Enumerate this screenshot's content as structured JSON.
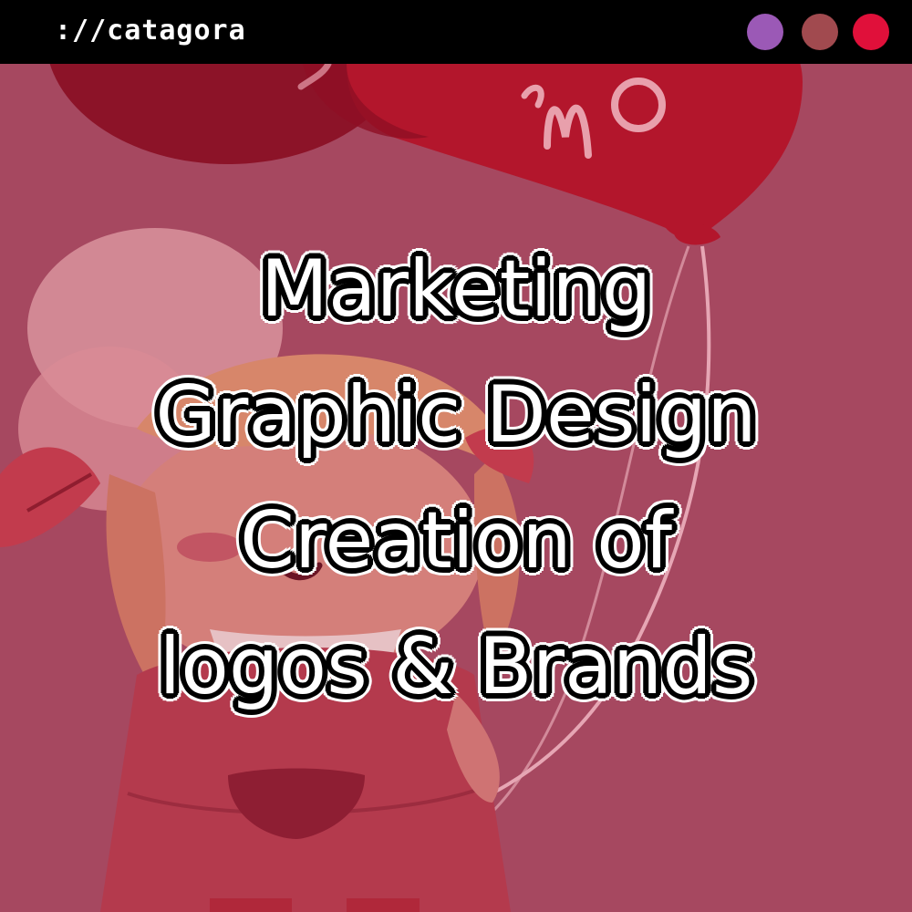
{
  "titlebar": {
    "brand": "://catagora",
    "buttons": [
      {
        "color": "#9b59b6"
      },
      {
        "color": "#a14a4f"
      },
      {
        "color": "#e0103a"
      }
    ]
  },
  "headline": {
    "lines": [
      "Marketing",
      "Graphic Design",
      "Creation of",
      "logos & Brands"
    ]
  },
  "background": {
    "balloon_text": "Mo",
    "colors": {
      "backdrop": "#a64860",
      "balloon_dark": "#8c0d24",
      "balloon": "#b81a30",
      "character_skin": "#d98a7e",
      "character_dress": "#b53a4c",
      "hair": "#d8856a"
    }
  }
}
